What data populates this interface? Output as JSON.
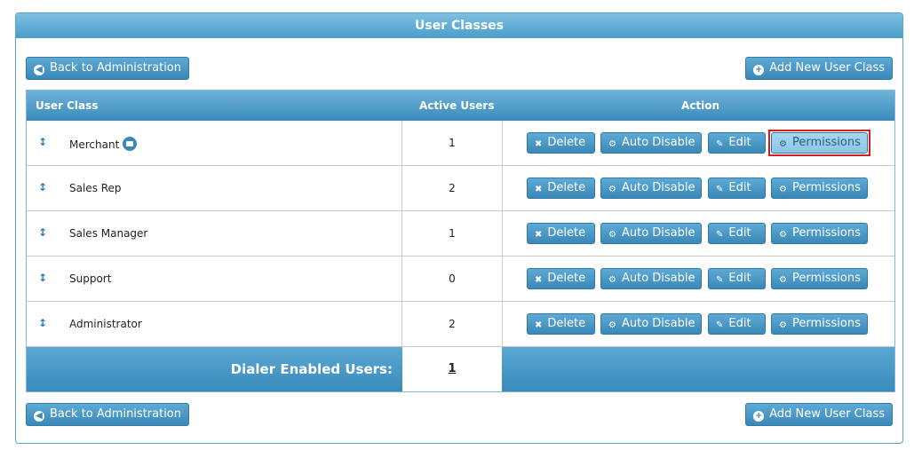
{
  "panel": {
    "title": "User Classes"
  },
  "top_bar": {
    "back_label": "Back to Administration",
    "add_label": "Add New User Class"
  },
  "bottom_bar": {
    "back_label": "Back to Administration",
    "add_label": "Add New User Class"
  },
  "table": {
    "headers": {
      "user_class": "User Class",
      "active_users": "Active Users",
      "action": "Action"
    },
    "rows": [
      {
        "name": "Merchant",
        "active_users": "1",
        "has_badge": true
      },
      {
        "name": "Sales Rep",
        "active_users": "2"
      },
      {
        "name": "Sales Manager",
        "active_users": "1"
      },
      {
        "name": "Support",
        "active_users": "0"
      },
      {
        "name": "Administrator",
        "active_users": "2"
      }
    ],
    "actions": {
      "delete": "Delete",
      "auto_disable": "Auto Disable",
      "edit": "Edit",
      "permissions": "Permissions"
    },
    "footer": {
      "label": "Dialer Enabled Users:",
      "value": "1"
    }
  },
  "colors": {
    "accent": "#3a88b8",
    "highlight_border": "#d81b1b"
  },
  "icons": {
    "back": "circle-arrow-left-icon",
    "add": "circle-plus-icon",
    "delete": "x-icon",
    "auto_disable": "gear-icon",
    "edit": "pencil-icon",
    "permissions": "gear-icon",
    "drag": "drag-handle-icon",
    "badge": "briefcase-icon"
  },
  "highlighted": {
    "row": 0,
    "action": "permissions"
  }
}
